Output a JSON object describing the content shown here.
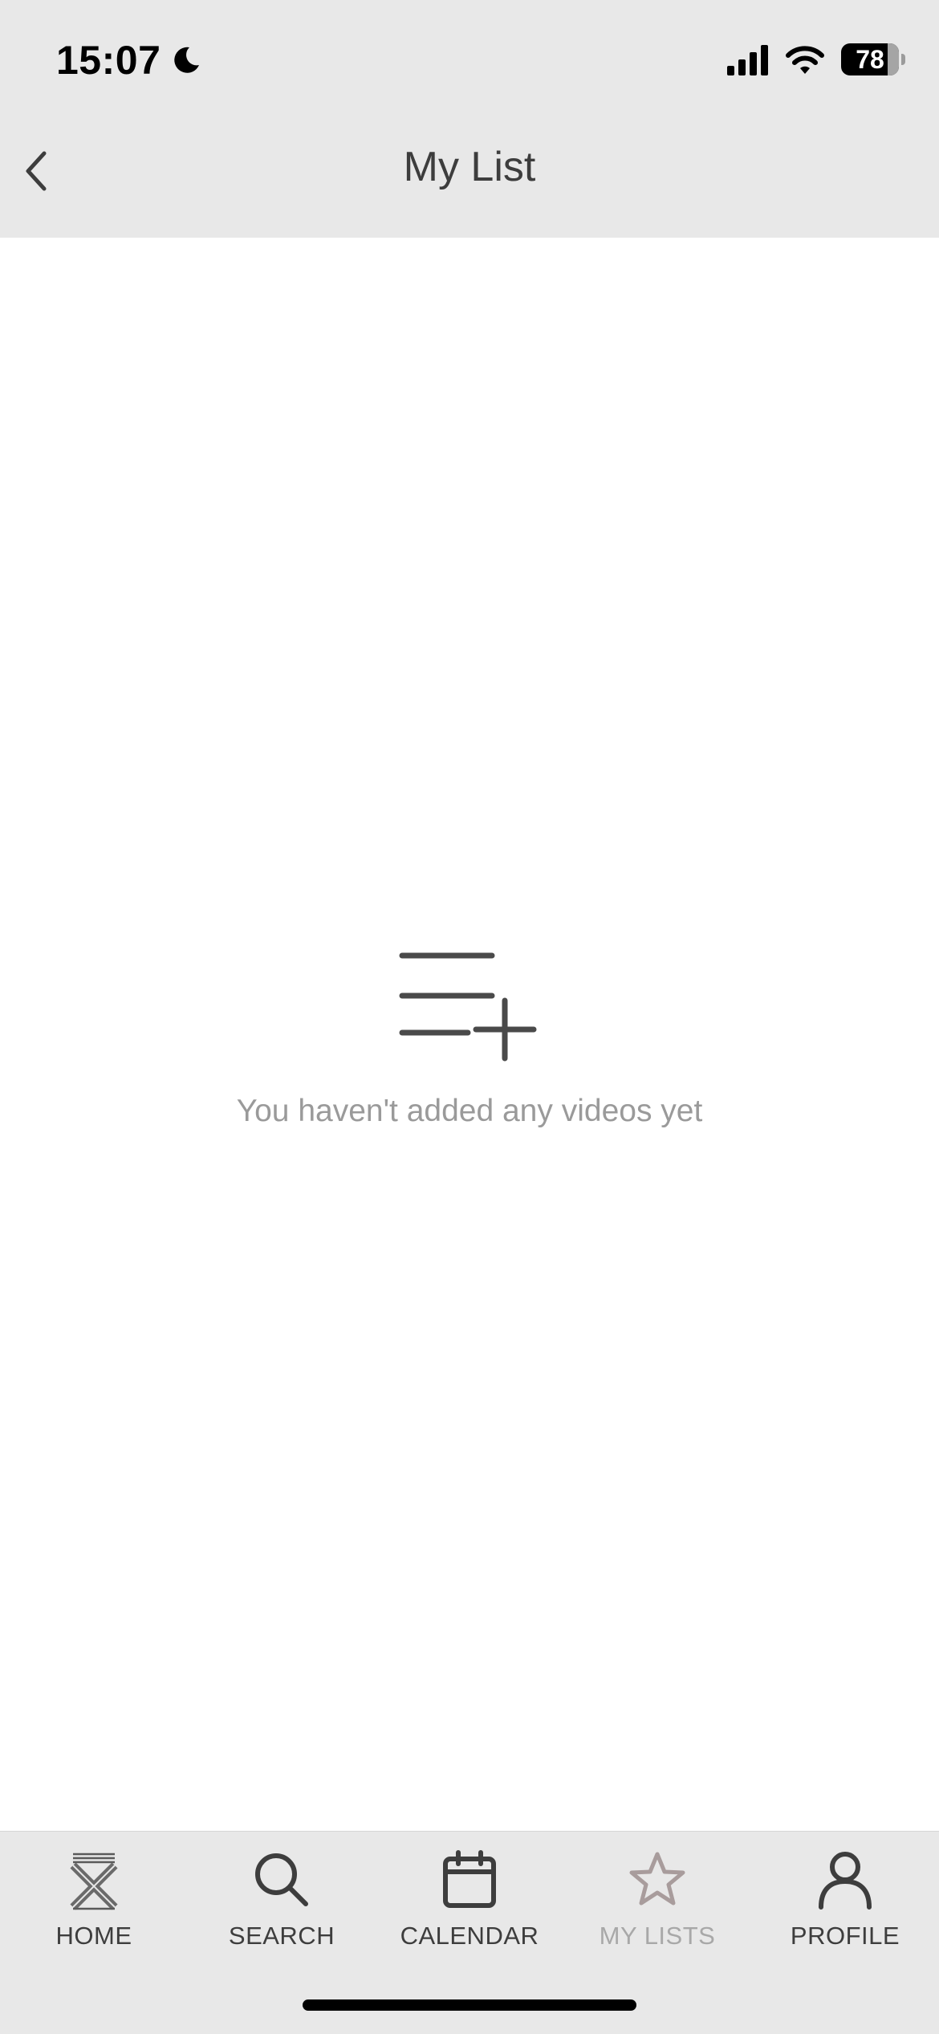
{
  "status_bar": {
    "time": "15:07",
    "battery_level": "78"
  },
  "header": {
    "title": "My List"
  },
  "empty_state": {
    "message": "You haven't added any videos yet"
  },
  "tab_bar": {
    "tabs": [
      {
        "label": "HOME",
        "icon": "home-x-logo-icon",
        "active": false
      },
      {
        "label": "SEARCH",
        "icon": "search-icon",
        "active": false
      },
      {
        "label": "CALENDAR",
        "icon": "calendar-icon",
        "active": false
      },
      {
        "label": "MY LISTS",
        "icon": "star-icon",
        "active": true
      },
      {
        "label": "PROFILE",
        "icon": "person-icon",
        "active": false
      }
    ]
  },
  "colors": {
    "bar_background": "#e8e8e8",
    "text_dark": "#3d3d3d",
    "text_muted": "#9a9a9a",
    "active_tab": "#a8a8a8"
  }
}
